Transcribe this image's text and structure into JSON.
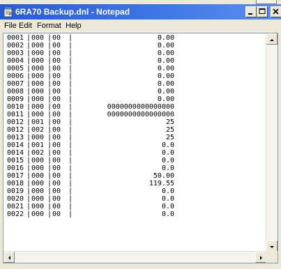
{
  "window": {
    "title": "6RA70 Backup.dnl - Notepad"
  },
  "menu": [
    "File",
    "Edit",
    "Format",
    "Help"
  ],
  "lines": [
    {
      "a": "0001",
      "b": "000",
      "c": "00",
      "v": "0.00"
    },
    {
      "a": "0002",
      "b": "000",
      "c": "00",
      "v": "0.00"
    },
    {
      "a": "0003",
      "b": "000",
      "c": "00",
      "v": "0.00"
    },
    {
      "a": "0004",
      "b": "000",
      "c": "00",
      "v": "0.00"
    },
    {
      "a": "0005",
      "b": "000",
      "c": "00",
      "v": "0.00"
    },
    {
      "a": "0006",
      "b": "000",
      "c": "00",
      "v": "0.00"
    },
    {
      "a": "0007",
      "b": "000",
      "c": "00",
      "v": "0.00"
    },
    {
      "a": "0008",
      "b": "000",
      "c": "00",
      "v": "0.00"
    },
    {
      "a": "0009",
      "b": "000",
      "c": "00",
      "v": "0.00"
    },
    {
      "a": "0010",
      "b": "000",
      "c": "00",
      "v": "0000000000000000"
    },
    {
      "a": "0011",
      "b": "000",
      "c": "00",
      "v": "0000000000000000"
    },
    {
      "a": "0012",
      "b": "001",
      "c": "00",
      "v": "25"
    },
    {
      "a": "0012",
      "b": "002",
      "c": "00",
      "v": "25"
    },
    {
      "a": "0013",
      "b": "000",
      "c": "00",
      "v": "25"
    },
    {
      "a": "0014",
      "b": "001",
      "c": "00",
      "v": "0.0"
    },
    {
      "a": "0014",
      "b": "002",
      "c": "00",
      "v": "0.0"
    },
    {
      "a": "0015",
      "b": "000",
      "c": "00",
      "v": "0.0"
    },
    {
      "a": "0016",
      "b": "000",
      "c": "00",
      "v": "0.0"
    },
    {
      "a": "0017",
      "b": "000",
      "c": "00",
      "v": "50.00"
    },
    {
      "a": "0018",
      "b": "000",
      "c": "00",
      "v": "119.55"
    },
    {
      "a": "0019",
      "b": "000",
      "c": "00",
      "v": "0.0"
    },
    {
      "a": "0020",
      "b": "000",
      "c": "00",
      "v": "0.0"
    },
    {
      "a": "0021",
      "b": "000",
      "c": "00",
      "v": "0.0"
    },
    {
      "a": "0022",
      "b": "000",
      "c": "00",
      "v": "0.0"
    }
  ],
  "icons": {
    "app": "notepad-icon",
    "minimize": "minimize-icon",
    "maximize": "maximize-icon",
    "close": "close-icon"
  }
}
